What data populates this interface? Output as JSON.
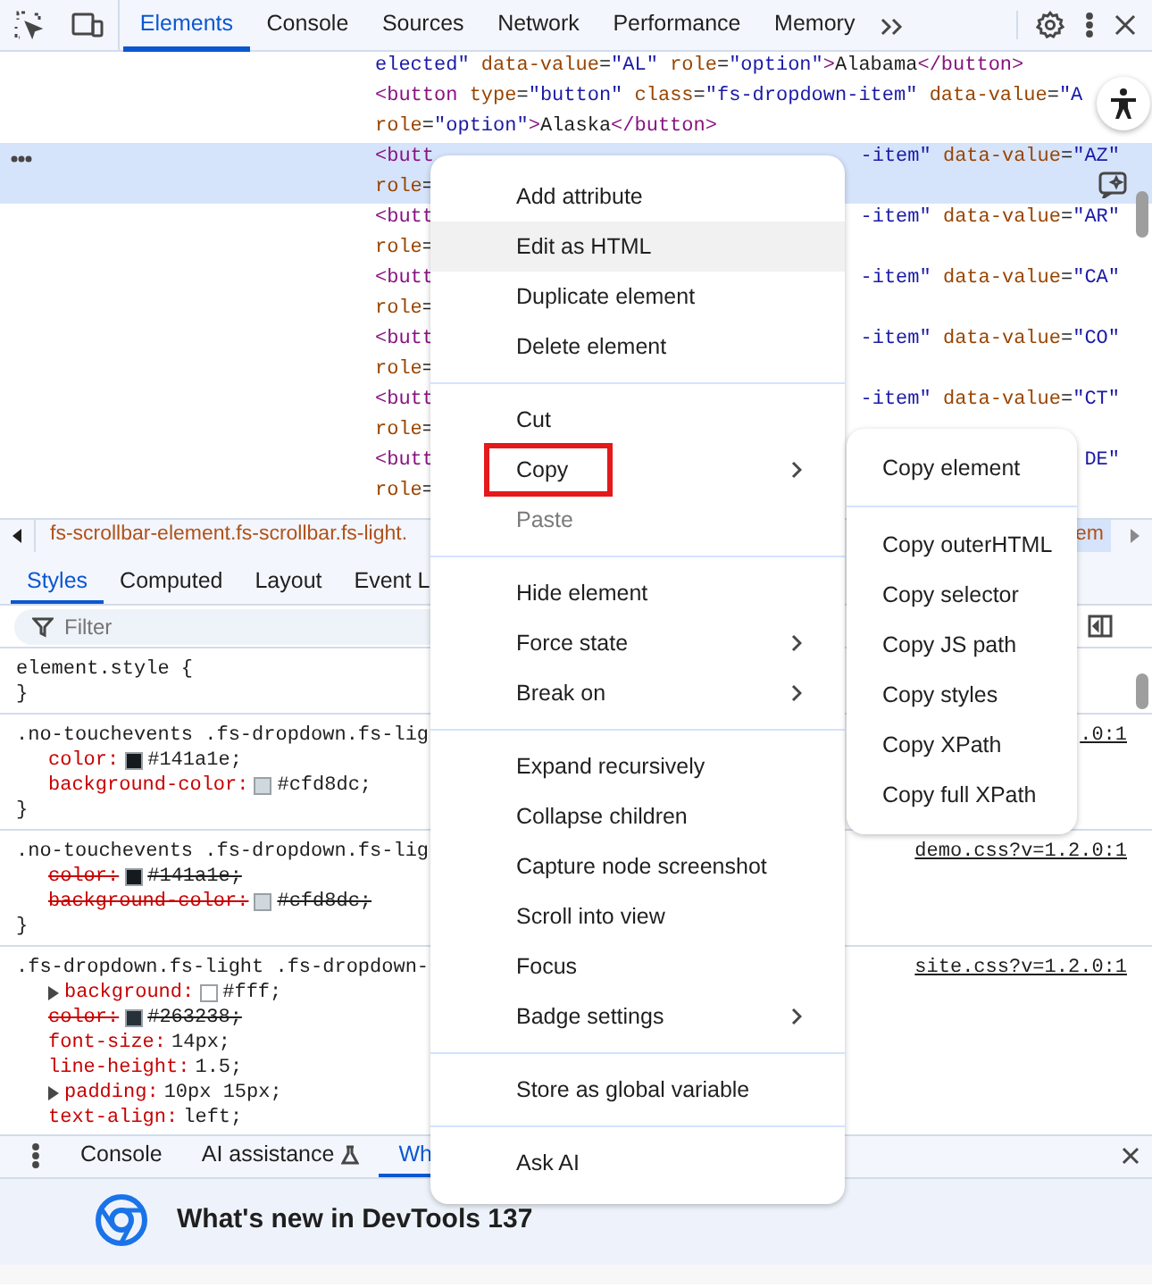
{
  "toolbar": {
    "tabs": [
      {
        "label": "Elements",
        "selected": true
      },
      {
        "label": "Console",
        "selected": false
      },
      {
        "label": "Sources",
        "selected": false
      },
      {
        "label": "Network",
        "selected": false
      },
      {
        "label": "Performance",
        "selected": false
      },
      {
        "label": "Memory",
        "selected": false
      }
    ]
  },
  "elements_tree": {
    "nodes": [
      {
        "selected": false,
        "lines": [
          {
            "text": "elected\" data-value=\"AL\" role=\"option\">Alabama</button>"
          }
        ]
      },
      {
        "selected": false,
        "lines": [
          {
            "text": "<button type=\"button\" class=\"fs-dropdown-item\" data-value=\"A"
          },
          {
            "text": "role=\"option\">Alaska</button>"
          }
        ]
      },
      {
        "selected": true,
        "lines": [
          {
            "text": "<butt",
            "tail": "-item\" data-value=\"AZ\""
          },
          {
            "text": "role="
          }
        ]
      },
      {
        "selected": false,
        "lines": [
          {
            "text": "<butt",
            "tail": "-item\" data-value=\"AR\""
          },
          {
            "text": "role="
          }
        ]
      },
      {
        "selected": false,
        "lines": [
          {
            "text": "<butt",
            "tail": "-item\" data-value=\"CA\""
          },
          {
            "text": "role="
          }
        ]
      },
      {
        "selected": false,
        "lines": [
          {
            "text": "<butt",
            "tail": "-item\" data-value=\"CO\""
          },
          {
            "text": "role="
          }
        ]
      },
      {
        "selected": false,
        "lines": [
          {
            "text": "<butt",
            "tail": "-item\" data-value=\"CT\""
          },
          {
            "text": "role="
          }
        ]
      },
      {
        "selected": false,
        "lines": [
          {
            "text": "<butt",
            "tail": "DE\""
          },
          {
            "text": "role="
          }
        ]
      }
    ]
  },
  "breadcrumbs": {
    "left_text": "fs-scrollbar-element.fs-scrollbar.fs-light.",
    "right_text": "em"
  },
  "styles_panel": {
    "tabs": [
      {
        "label": "Styles",
        "selected": true
      },
      {
        "label": "Computed",
        "selected": false
      },
      {
        "label": "Layout",
        "selected": false
      },
      {
        "label": "Event L",
        "selected": false
      }
    ],
    "filter": {
      "placeholder": "Filter"
    },
    "rules": [
      {
        "selector": "element.style {",
        "close": "}"
      },
      {
        "selector": ".no-touchevents .fs-dropdown.fs-lig",
        "link": ".0:1",
        "close": "}",
        "declarations": [
          {
            "name": "color:",
            "value": "#141a1e;",
            "color": "#141a1e",
            "struck": false,
            "expandable": false
          },
          {
            "name": "background-color:",
            "value": "#cfd8dc;",
            "color": "#cfd8dc",
            "struck": false,
            "expandable": false
          }
        ]
      },
      {
        "selector": ".no-touchevents .fs-dropdown.fs-lig",
        "link": "demo.css?v=1.2.0:1",
        "close": "}",
        "declarations": [
          {
            "name": "color:",
            "value": "#141a1e;",
            "color": "#141a1e",
            "struck": true,
            "expandable": false
          },
          {
            "name": "background-color:",
            "value": "#cfd8dc;",
            "color": "#cfd8dc",
            "struck": true,
            "expandable": false
          }
        ]
      },
      {
        "selector": ".fs-dropdown.fs-light .fs-dropdown-",
        "link": "site.css?v=1.2.0:1",
        "declarations": [
          {
            "name": "background:",
            "value": "#fff;",
            "color": "#ffffff",
            "struck": false,
            "expandable": true
          },
          {
            "name": "color:",
            "value": "#263238;",
            "color": "#263238",
            "struck": true,
            "expandable": false
          },
          {
            "name": "font-size:",
            "value": "14px;",
            "struck": false,
            "expandable": false
          },
          {
            "name": "line-height:",
            "value": "1.5;",
            "struck": false,
            "expandable": false
          },
          {
            "name": "padding:",
            "value": "10px 15px;",
            "struck": false,
            "expandable": true
          },
          {
            "name": "text-align:",
            "value": "left;",
            "struck": false,
            "expandable": false
          }
        ]
      }
    ]
  },
  "drawer": {
    "tabs": [
      {
        "label": "Console",
        "selected": false,
        "kind": "plain"
      },
      {
        "label": "AI assistance",
        "selected": false,
        "kind": "experimental"
      },
      {
        "label": "Wh",
        "selected": true,
        "kind": "plain"
      }
    ],
    "heading": "What's new in DevTools 137"
  },
  "context_menu": {
    "groups": [
      {
        "items": [
          {
            "label": "Add attribute",
            "hovered": false,
            "disabled": false,
            "submenu": false,
            "highlighted": false
          },
          {
            "label": "Edit as HTML",
            "hovered": true,
            "disabled": false,
            "submenu": false,
            "highlighted": false
          },
          {
            "label": "Duplicate element",
            "hovered": false,
            "disabled": false,
            "submenu": false,
            "highlighted": false
          },
          {
            "label": "Delete element",
            "hovered": false,
            "disabled": false,
            "submenu": false,
            "highlighted": false
          }
        ]
      },
      {
        "items": [
          {
            "label": "Cut",
            "hovered": false,
            "disabled": false,
            "submenu": false,
            "highlighted": false
          },
          {
            "label": "Copy",
            "hovered": false,
            "disabled": false,
            "submenu": true,
            "highlighted": true
          },
          {
            "label": "Paste",
            "hovered": false,
            "disabled": true,
            "submenu": false,
            "highlighted": false
          }
        ]
      },
      {
        "items": [
          {
            "label": "Hide element",
            "hovered": false,
            "disabled": false,
            "submenu": false,
            "highlighted": false
          },
          {
            "label": "Force state",
            "hovered": false,
            "disabled": false,
            "submenu": true,
            "highlighted": false
          },
          {
            "label": "Break on",
            "hovered": false,
            "disabled": false,
            "submenu": true,
            "highlighted": false
          }
        ]
      },
      {
        "items": [
          {
            "label": "Expand recursively",
            "hovered": false,
            "disabled": false,
            "submenu": false,
            "highlighted": false
          },
          {
            "label": "Collapse children",
            "hovered": false,
            "disabled": false,
            "submenu": false,
            "highlighted": false
          },
          {
            "label": "Capture node screenshot",
            "hovered": false,
            "disabled": false,
            "submenu": false,
            "highlighted": false
          },
          {
            "label": "Scroll into view",
            "hovered": false,
            "disabled": false,
            "submenu": false,
            "highlighted": false
          },
          {
            "label": "Focus",
            "hovered": false,
            "disabled": false,
            "submenu": false,
            "highlighted": false
          },
          {
            "label": "Badge settings",
            "hovered": false,
            "disabled": false,
            "submenu": true,
            "highlighted": false
          }
        ]
      },
      {
        "items": [
          {
            "label": "Store as global variable",
            "hovered": false,
            "disabled": false,
            "submenu": false,
            "highlighted": false
          }
        ]
      },
      {
        "items": [
          {
            "label": "Ask AI",
            "hovered": false,
            "disabled": false,
            "submenu": false,
            "highlighted": false
          }
        ]
      }
    ]
  },
  "copy_submenu": {
    "groups": [
      {
        "items": [
          {
            "label": "Copy element"
          }
        ]
      },
      {
        "items": [
          {
            "label": "Copy outerHTML"
          },
          {
            "label": "Copy selector"
          },
          {
            "label": "Copy JS path"
          },
          {
            "label": "Copy styles"
          },
          {
            "label": "Copy XPath"
          },
          {
            "label": "Copy full XPath"
          }
        ]
      }
    ]
  }
}
